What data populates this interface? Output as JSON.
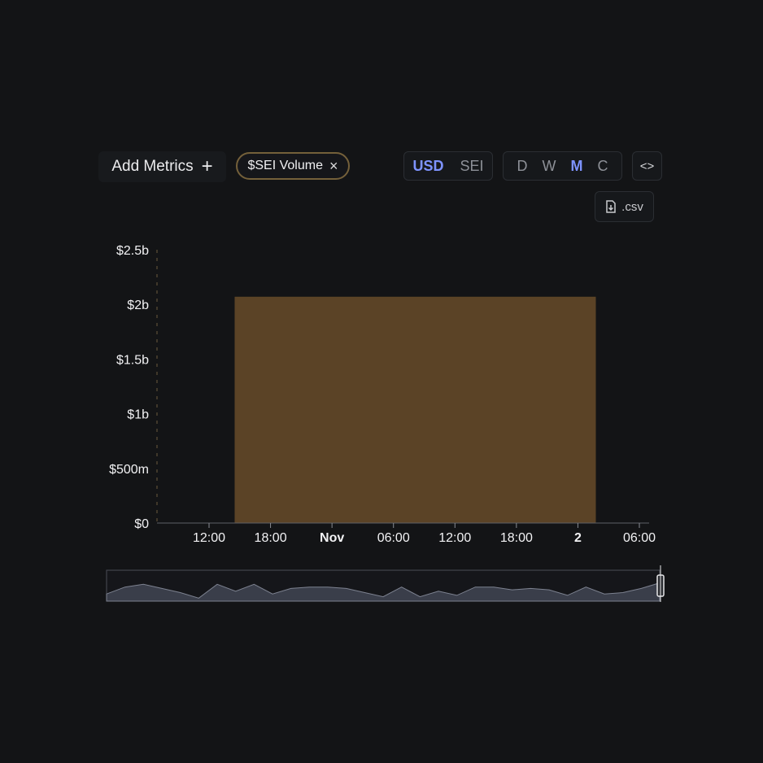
{
  "toolbar": {
    "add_metrics_label": "Add Metrics",
    "add_icon": "+",
    "metric_chip_label": "$SEI Volume",
    "remove_icon": "×",
    "currency_options": [
      "USD",
      "SEI"
    ],
    "currency_selected": "USD",
    "timeframe_options": [
      "D",
      "W",
      "M",
      "C"
    ],
    "timeframe_selected": "M",
    "embed_icon": "<>",
    "csv_label": ".csv",
    "csv_icon": "file-download-icon"
  },
  "colors": {
    "background": "#131416",
    "bar": "#5b4326",
    "accent": "#7e93ff",
    "chip_border": "#74603a",
    "brush_fill": "#3a3e4a"
  },
  "chart_data": {
    "type": "bar",
    "series": [
      {
        "x_start": "2023-10-31 14:30",
        "x_end": "2023-11-02 01:45",
        "value": 2.07
      }
    ],
    "y_unit": "billions USD",
    "ylim": [
      0,
      2.5
    ],
    "y_ticks": [
      "$0",
      "$500m",
      "$1b",
      "$1.5b",
      "$2b",
      "$2.5b"
    ],
    "x_ticks": [
      "12:00",
      "18:00",
      "Nov",
      "06:00",
      "12:00",
      "18:00",
      "2",
      "06:00"
    ],
    "bold_x_ticks": [
      "Nov",
      "2"
    ],
    "grid": false,
    "legend": "none",
    "brush_series": [
      0.2,
      0.45,
      0.55,
      0.4,
      0.25,
      0.05,
      0.55,
      0.3,
      0.55,
      0.2,
      0.4,
      0.45,
      0.45,
      0.4,
      0.25,
      0.1,
      0.45,
      0.1,
      0.3,
      0.15,
      0.45,
      0.45,
      0.35,
      0.4,
      0.35,
      0.15,
      0.45,
      0.2,
      0.25,
      0.4,
      0.6
    ]
  }
}
